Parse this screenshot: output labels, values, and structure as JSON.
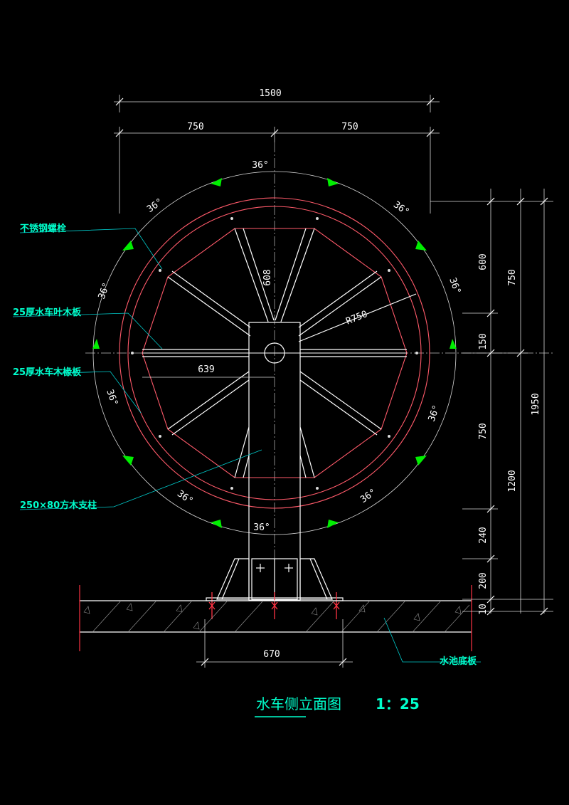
{
  "title": "水车侧立面图",
  "scale": "1：25",
  "dimensions": {
    "total_width": "1500",
    "half_left": "750",
    "half_right": "750",
    "radius": "R750",
    "spoke_length": "608",
    "blade_width": "639",
    "base_width": "670",
    "right_600": "600",
    "right_150": "150",
    "right_750_lower": "750",
    "right_240": "240",
    "right_200": "200",
    "right_10": "10",
    "right_1200": "1200",
    "right_750_upper": "750",
    "right_1950": "1950"
  },
  "angles": {
    "top": "36°",
    "upper_left": "36°",
    "upper_right": "36°",
    "left_upper": "36°",
    "right_upper": "36°",
    "left_lower": "36°",
    "right_lower": "36°",
    "lower_left": "36°",
    "lower_right": "36°",
    "bottom": "36°"
  },
  "labels": {
    "bolt": "不锈钢螺栓",
    "blade_board": "25厚水车叶木板",
    "rafter_board": "25厚水车木椽板",
    "post": "250×80方木支柱",
    "pool_floor": "水池底板"
  },
  "colors": {
    "background": "#000000",
    "wheel_rim": "#ff5a6a",
    "annotation": "#00ffcc",
    "arrow": "#00ee00",
    "linework": "#ffffff"
  }
}
